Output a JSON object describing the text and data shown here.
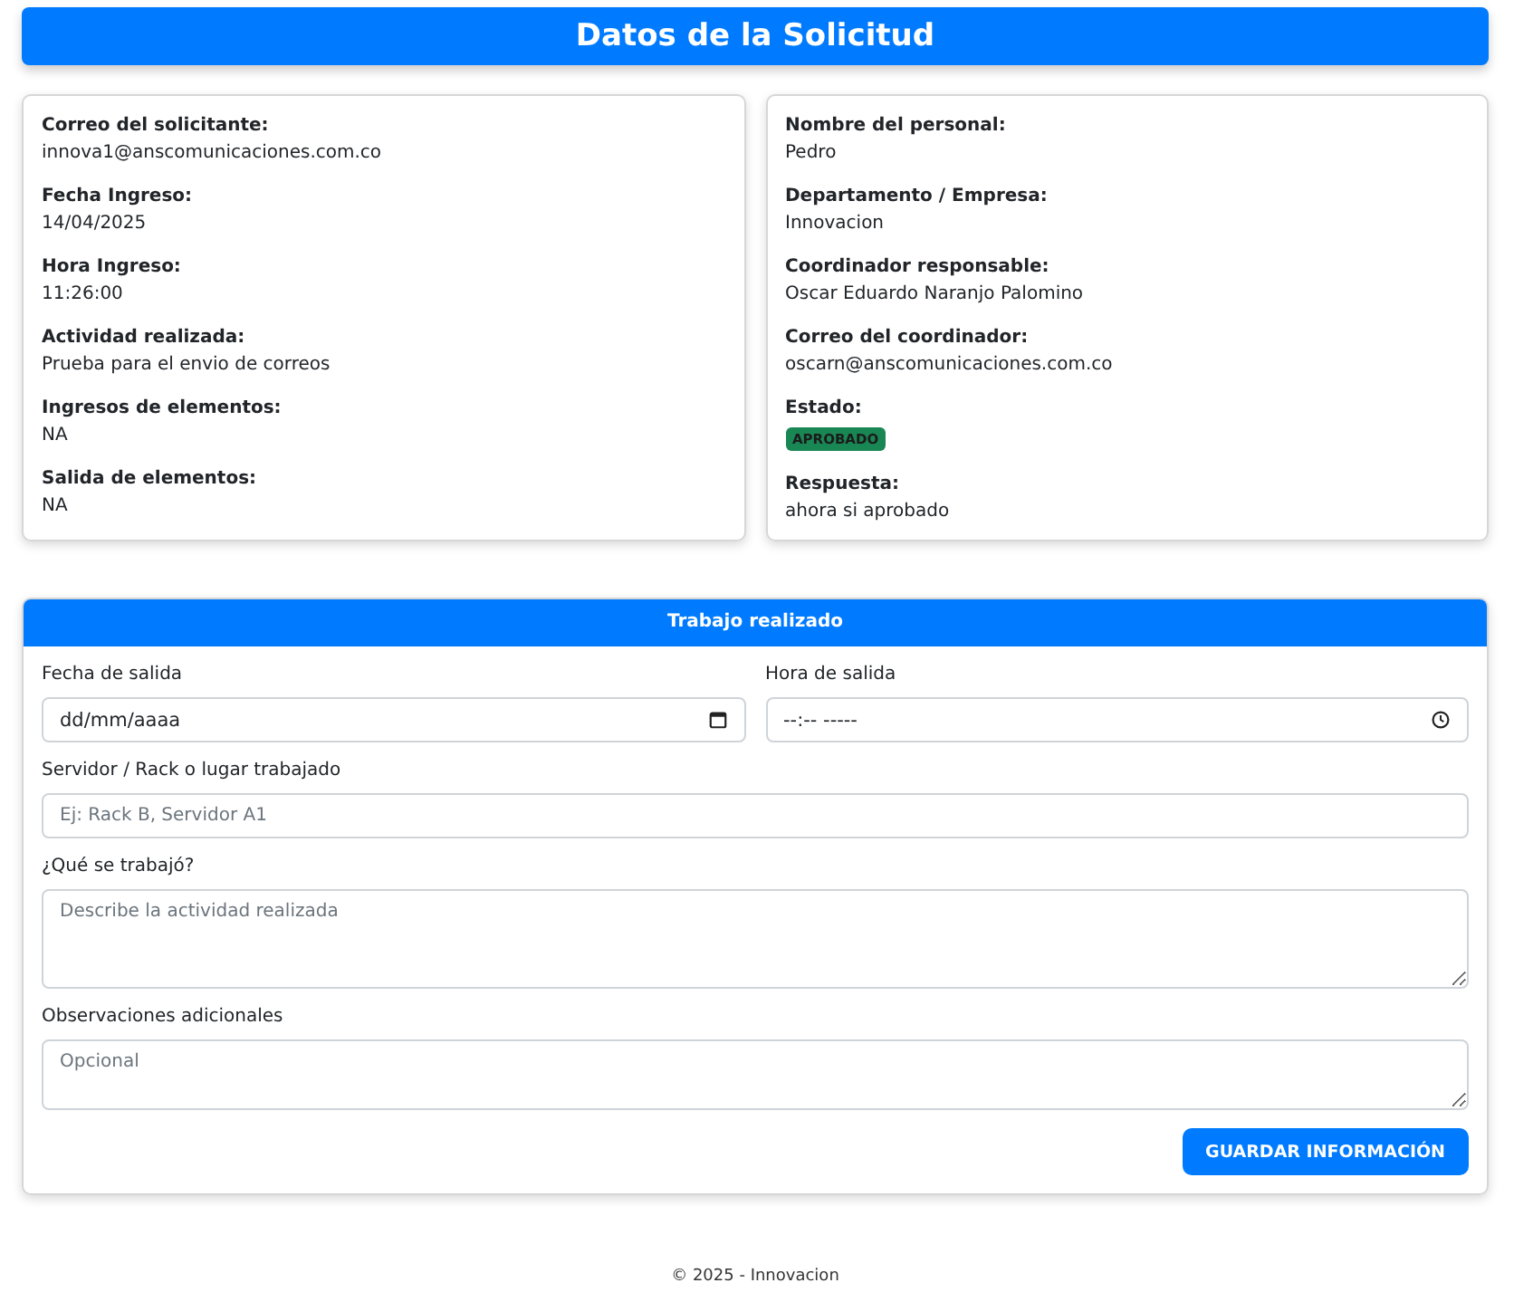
{
  "header": {
    "title": "Datos de la Solicitud"
  },
  "details": [
    [
      {
        "label": "Correo del solicitante:",
        "value": "innova1@anscomunicaciones.com.co",
        "kind": "text"
      },
      {
        "label": "Fecha Ingreso:",
        "value": "14/04/2025",
        "kind": "text"
      },
      {
        "label": "Hora Ingreso:",
        "value": "11:26:00",
        "kind": "text"
      },
      {
        "label": "Actividad realizada:",
        "value": "Prueba para el envio de correos",
        "kind": "text"
      },
      {
        "label": "Ingresos de elementos:",
        "value": "NA",
        "kind": "text"
      },
      {
        "label": "Salida de elementos:",
        "value": "NA",
        "kind": "text"
      }
    ],
    [
      {
        "label": "Nombre del personal:",
        "value": "Pedro",
        "kind": "text"
      },
      {
        "label": "Departamento / Empresa:",
        "value": "Innovacion",
        "kind": "text"
      },
      {
        "label": "Coordinador responsable:",
        "value": "Oscar Eduardo Naranjo Palomino",
        "kind": "text"
      },
      {
        "label": "Correo del coordinador:",
        "value": "oscarn@anscomunicaciones.com.co",
        "kind": "text"
      },
      {
        "label": "Estado:",
        "value": "APROBADO",
        "kind": "badge",
        "color": "#198754"
      },
      {
        "label": "Respuesta:",
        "value": "ahora si aprobado",
        "kind": "text"
      }
    ]
  ],
  "form": {
    "title": "Trabajo realizado",
    "rows": [
      [
        {
          "label": "Fecha de salida",
          "placeholder": "dd/mm/aaaa",
          "kind": "date"
        },
        {
          "label": "Hora de salida",
          "placeholder": "--:-- -----",
          "kind": "time"
        }
      ],
      [
        {
          "label": "Servidor / Rack o lugar trabajado",
          "placeholder": "Ej: Rack B, Servidor A1",
          "kind": "text"
        }
      ],
      [
        {
          "label": "¿Qué se trabajó?",
          "placeholder": "Describe la actividad realizada",
          "kind": "textarea-large"
        }
      ],
      [
        {
          "label": "Observaciones adicionales",
          "placeholder": "Opcional",
          "kind": "textarea"
        }
      ]
    ],
    "button": "GUARDAR INFORMACIÓN"
  },
  "footer": "© 2025 - Innovacion"
}
